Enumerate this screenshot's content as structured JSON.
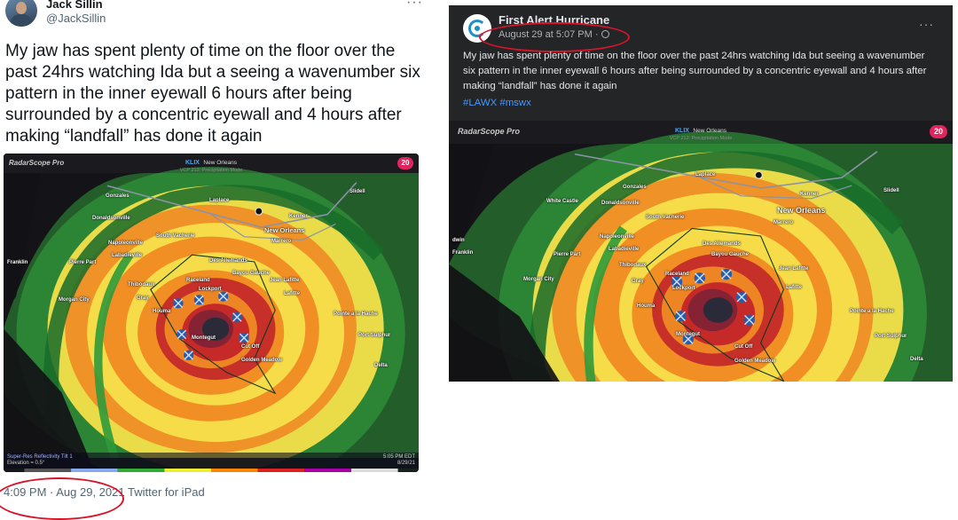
{
  "tweet": {
    "author_name": "Jack Sillin",
    "handle": "@JackSillin",
    "text": "My jaw has spent plenty of time on the floor over the past 24hrs watching Ida but a seeing a wavenumber six pattern in the inner eyewall 6 hours after being surrounded by a concentric eyewall and 4 hours after making “landfall” has done it again",
    "timestamp": "4:09 PM · Aug 29, 2021",
    "source": "Twitter for iPad",
    "more_glyph": "···"
  },
  "facebook_post": {
    "page_name": "First Alert Hurricane",
    "timestamp": "August 29 at 5:07 PM ·",
    "text": "My jaw has spent plenty of time on the floor over the past 24hrs watching Ida but seeing a wavenumber six pattern in the inner eyewall 6 hours after being surrounded by a concentric eyewall and 4 hours after making “landfall” has done it again",
    "hashtags": "#LAWX #mswx",
    "more_glyph": "···"
  },
  "radar": {
    "app_name": "RadarScope Pro",
    "station": "KLIX",
    "station_city": "New Orleans",
    "vcp_mode": "VCP 212: Precipitation Mode",
    "badge": "20",
    "product": "Super-Res Reflectivity Tilt 1",
    "elevation": "Elevation = 0.5°",
    "time": "5:05 PM EDT",
    "date": "8/29/21",
    "labels": {
      "new_orleans": "New Orleans",
      "franklin": "Franklin",
      "morgan_city": "Morgan City",
      "montegut": "Montegut",
      "houma": "Houma",
      "thibodaux": "Thibodaux",
      "raceland": "Raceland",
      "lockport": "Lockport",
      "golden_meadow": "Golden Meadow",
      "cut_off": "Cut Off",
      "laplace": "Laplace",
      "kenner": "Kenner",
      "slidell": "Slidell",
      "marrero": "Marrero",
      "des_allemands": "Des Allemands",
      "bayou_gauche": "Bayou Gauche",
      "lafitte": "Lafitte",
      "jean_lafitte": "Jean Lafitte",
      "pointe_a_la_hache": "Pointe a la Hache",
      "port_sulphur": "Port Sulphur",
      "delta": "Delta",
      "gonzales": "Gonzales",
      "donaldsonville": "Donaldsonville",
      "napoleonville": "Napoleonville",
      "south_vacherie": "South Vacherie",
      "white_castle": "White Castle",
      "labadieville": "Labadieville",
      "pierre_part": "Pierre Part",
      "gray": "Gray",
      "dwin": "dwin"
    },
    "colors": {
      "band_red": "#c0202a",
      "band_orange": "#f08a24",
      "band_yellow": "#f4e04a",
      "band_green": "#2f9a3a",
      "band_darkgreen": "#186b2a",
      "background": "#141418"
    }
  },
  "annotations": {
    "highlight_color": "#d7142a"
  }
}
